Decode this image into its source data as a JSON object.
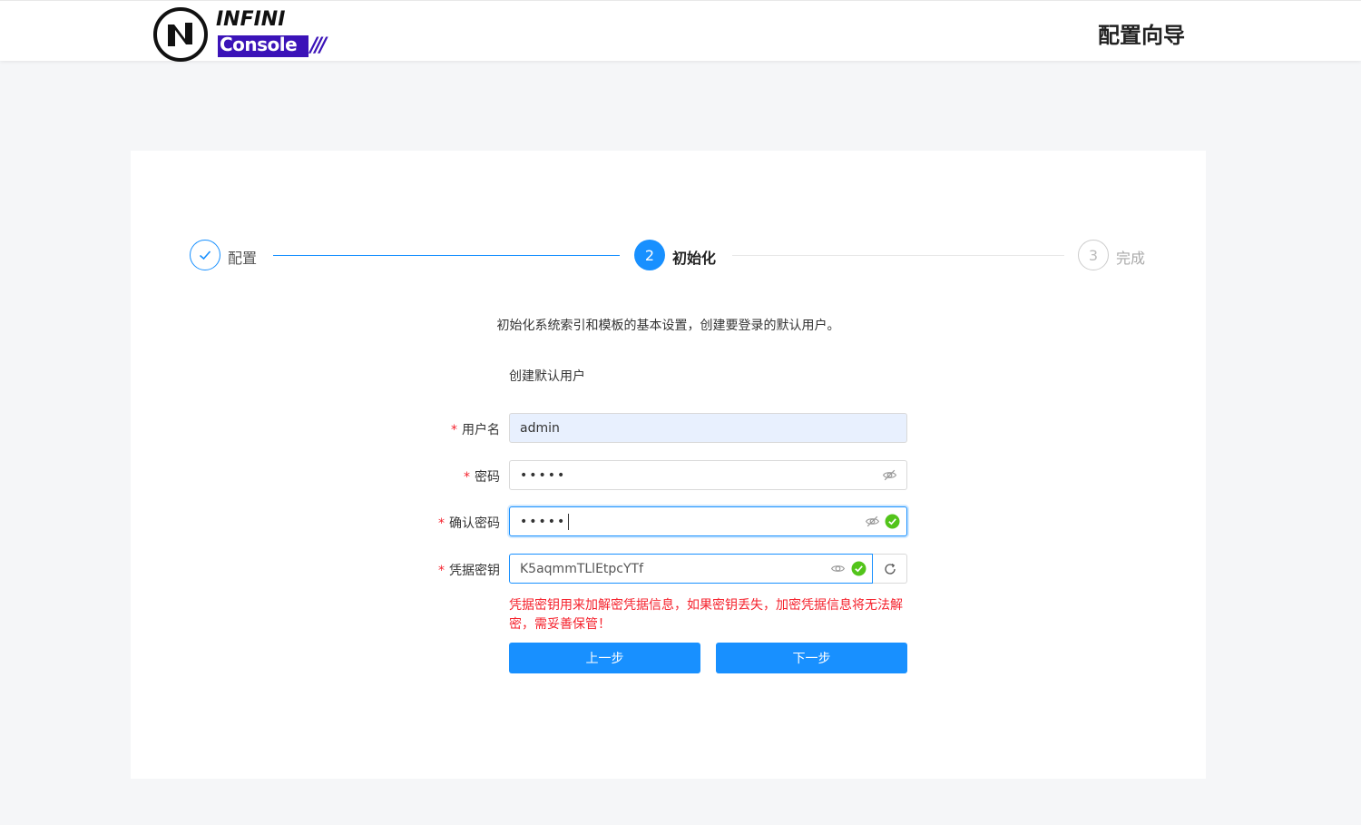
{
  "header": {
    "logo_text_top": "INFINI",
    "logo_text_bottom": "Console",
    "logo_slashes": "///",
    "title": "配置向导"
  },
  "steps": [
    {
      "label": "配置",
      "status": "finished",
      "icon": "check-icon"
    },
    {
      "number": "2",
      "label": "初始化",
      "status": "active"
    },
    {
      "number": "3",
      "label": "完成",
      "status": "waiting"
    }
  ],
  "intro": "初始化系统索引和模板的基本设置，创建要登录的默认用户。",
  "form": {
    "section_title": "创建默认用户",
    "required_mark": "*",
    "username": {
      "label": "用户名",
      "value": "admin"
    },
    "password": {
      "label": "密码",
      "value": "•••••"
    },
    "confirm_password": {
      "label": "确认密码",
      "value": "•••••"
    },
    "credential_key": {
      "label": "凭据密钥",
      "value": "K5aqmmTLlEtpcYTf"
    },
    "warning": "凭据密钥用来加解密凭据信息，如果密钥丢失，加密凭据信息将无法解密，需妥善保管！"
  },
  "buttons": {
    "prev": "上一步",
    "next": "下一步"
  },
  "colors": {
    "primary": "#1890ff",
    "error": "#f5222d",
    "success": "#52c41a",
    "brand": "#3b13b8"
  }
}
